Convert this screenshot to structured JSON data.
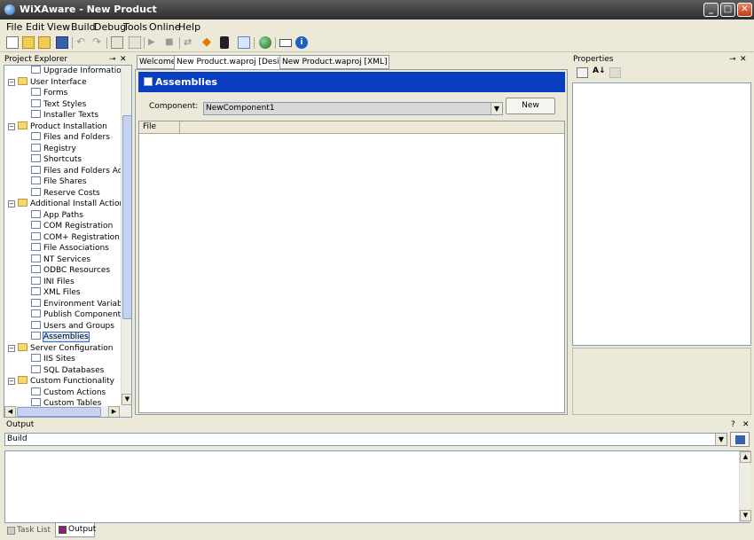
{
  "window": {
    "title": "WiXAware - New Product"
  },
  "menu": [
    "File",
    "Edit",
    "View",
    "Build",
    "Debug",
    "Tools",
    "Online",
    "Help"
  ],
  "toolbar_icons": [
    "new-file-icon",
    "open-folder-icon",
    "open-project-icon",
    "save-icon",
    "undo-icon",
    "redo-icon",
    "properties-icon",
    "copy-icon",
    "play-icon",
    "stop-icon",
    "build-icon",
    "diamond-icon",
    "traffic-light-icon",
    "check-icon",
    "globe-icon",
    "window-icon",
    "info-icon"
  ],
  "project_explorer": {
    "title": "Project Explorer",
    "items": [
      {
        "label": "Upgrade Information",
        "indent": 2,
        "type": "leaf"
      },
      {
        "label": "User Interface",
        "indent": 1,
        "type": "folder",
        "expanded": true
      },
      {
        "label": "Forms",
        "indent": 2,
        "type": "leaf"
      },
      {
        "label": "Text Styles",
        "indent": 2,
        "type": "leaf"
      },
      {
        "label": "Installer Texts",
        "indent": 2,
        "type": "leaf"
      },
      {
        "label": "Product Installation",
        "indent": 1,
        "type": "folder",
        "expanded": true
      },
      {
        "label": "Files and Folders",
        "indent": 2,
        "type": "leaf"
      },
      {
        "label": "Registry",
        "indent": 2,
        "type": "leaf"
      },
      {
        "label": "Shortcuts",
        "indent": 2,
        "type": "leaf"
      },
      {
        "label": "Files and Folders Actions",
        "indent": 2,
        "type": "leaf"
      },
      {
        "label": "File Shares",
        "indent": 2,
        "type": "leaf"
      },
      {
        "label": "Reserve Costs",
        "indent": 2,
        "type": "leaf"
      },
      {
        "label": "Additional Install Actions",
        "indent": 1,
        "type": "folder",
        "expanded": true
      },
      {
        "label": "App Paths",
        "indent": 2,
        "type": "leaf"
      },
      {
        "label": "COM Registration",
        "indent": 2,
        "type": "leaf"
      },
      {
        "label": "COM+ Registration",
        "indent": 2,
        "type": "leaf"
      },
      {
        "label": "File Associations",
        "indent": 2,
        "type": "leaf"
      },
      {
        "label": "NT Services",
        "indent": 2,
        "type": "leaf"
      },
      {
        "label": "ODBC Resources",
        "indent": 2,
        "type": "leaf"
      },
      {
        "label": "INI Files",
        "indent": 2,
        "type": "leaf"
      },
      {
        "label": "XML Files",
        "indent": 2,
        "type": "leaf"
      },
      {
        "label": "Environment Variables",
        "indent": 2,
        "type": "leaf"
      },
      {
        "label": "Publish Components",
        "indent": 2,
        "type": "leaf"
      },
      {
        "label": "Users and Groups",
        "indent": 2,
        "type": "leaf"
      },
      {
        "label": "Assemblies",
        "indent": 2,
        "type": "leaf",
        "selected": true
      },
      {
        "label": "Server Configuration",
        "indent": 1,
        "type": "folder",
        "expanded": true
      },
      {
        "label": "IIS Sites",
        "indent": 2,
        "type": "leaf"
      },
      {
        "label": "SQL Databases",
        "indent": 2,
        "type": "leaf"
      },
      {
        "label": "Custom Functionality",
        "indent": 1,
        "type": "folder",
        "expanded": true
      },
      {
        "label": "Custom Actions",
        "indent": 2,
        "type": "leaf"
      },
      {
        "label": "Custom Tables",
        "indent": 2,
        "type": "leaf"
      }
    ]
  },
  "tabs": [
    {
      "label": "Welcome",
      "active": false
    },
    {
      "label": "New Product.waproj [Design]",
      "active": true
    },
    {
      "label": "New Product.waproj [XML]",
      "active": false
    }
  ],
  "assemblies": {
    "header": "Assemblies",
    "component_label": "Component:",
    "component_value": "NewComponent1",
    "new_button": "New",
    "column_file": "File"
  },
  "properties": {
    "title": "Properties"
  },
  "output": {
    "title": "Output",
    "source": "Build",
    "tab_task_list": "Task List",
    "tab_output": "Output"
  },
  "colors": {
    "header_blue": "#0a3ec1",
    "accent": "#316ac5"
  }
}
